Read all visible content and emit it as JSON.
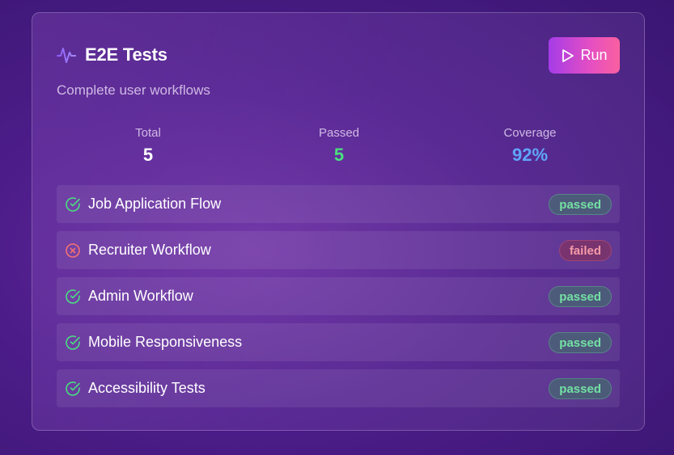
{
  "card": {
    "title": "E2E Tests",
    "title_icon": "activity-pulse-icon",
    "subtitle": "Complete user workflows",
    "run_button": {
      "label": "Run",
      "icon": "play-icon"
    }
  },
  "stats": [
    {
      "label": "Total",
      "value": "5",
      "color": "#ffffff"
    },
    {
      "label": "Passed",
      "value": "5",
      "color": "#4ade80"
    },
    {
      "label": "Coverage",
      "value": "92%",
      "color": "#60a5fa"
    }
  ],
  "tests": [
    {
      "name": "Job Application Flow",
      "status": "passed",
      "icon": "check-circle-icon"
    },
    {
      "name": "Recruiter Workflow",
      "status": "failed",
      "icon": "x-circle-icon"
    },
    {
      "name": "Admin Workflow",
      "status": "passed",
      "icon": "check-circle-icon"
    },
    {
      "name": "Mobile Responsiveness",
      "status": "passed",
      "icon": "check-circle-icon"
    },
    {
      "name": "Accessibility Tests",
      "status": "passed",
      "icon": "check-circle-icon"
    }
  ],
  "colors": {
    "accent_start": "#a53ce8",
    "accent_end": "#f9609f",
    "passed": "#4ade80",
    "failed": "#f87171",
    "coverage": "#60a5fa"
  }
}
